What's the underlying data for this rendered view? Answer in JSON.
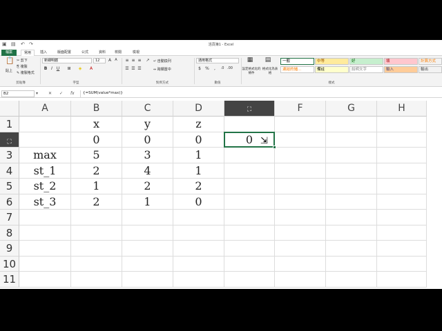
{
  "title_bar": {
    "doc_title": "活頁簿1 - Excel",
    "qa_icons": [
      "save-icon",
      "undo-icon",
      "redo-icon"
    ]
  },
  "ribbon": {
    "tabs": [
      {
        "label": "檔案",
        "state": "file"
      },
      {
        "label": "常用",
        "state": "active"
      },
      {
        "label": "插入"
      },
      {
        "label": "版面配置"
      },
      {
        "label": "公式"
      },
      {
        "label": "資料"
      },
      {
        "label": "校閱"
      },
      {
        "label": "檢視"
      }
    ],
    "clipboard": {
      "paste_label": "貼上",
      "cut_label": "剪下",
      "copy_label": "複製",
      "format_painter_label": "複製格式",
      "group_label": "剪貼簿"
    },
    "font": {
      "name": "新細明體",
      "size": "12",
      "group_label": "字型"
    },
    "alignment": {
      "wrap_label": "自動換列",
      "merge_label": "跨欄置中",
      "group_label": "對齊方式"
    },
    "number": {
      "format": "通用格式",
      "group_label": "數值"
    },
    "styles": {
      "conditional_label": "設定格式化的條件",
      "table_label": "格式化為表格",
      "cells": [
        {
          "label": "一般",
          "bg": "#ffffff",
          "color": "#000000",
          "border": "#217346"
        },
        {
          "label": "中等",
          "bg": "#ffeb9c",
          "color": "#9c5700"
        },
        {
          "label": "好",
          "bg": "#c6efce",
          "color": "#006100"
        },
        {
          "label": "壞",
          "bg": "#ffc7ce",
          "color": "#9c0006"
        },
        {
          "label": "計算方式",
          "bg": "#f2f2f2",
          "color": "#fa7d00"
        },
        {
          "label": "連結的儲...",
          "bg": "#ffffff",
          "color": "#fa7d00"
        },
        {
          "label": "備註",
          "bg": "#ffffcc",
          "color": "#000000"
        },
        {
          "label": "說明文字",
          "bg": "#ffffff",
          "color": "#7f7f7f"
        },
        {
          "label": "輸入",
          "bg": "#ffcc99",
          "color": "#3f3f76"
        },
        {
          "label": "輸出",
          "bg": "#f2f2f2",
          "color": "#3f3f3f"
        }
      ],
      "group_label": "樣式"
    }
  },
  "formula_bar": {
    "name_box": "B2",
    "formula": "{=SUM(value*max)}"
  },
  "sheet": {
    "columns": [
      "A",
      "B",
      "C",
      "D",
      "E",
      "F",
      "G",
      "H"
    ],
    "selected_column": "E",
    "rows": [
      {
        "n": "1",
        "cells": [
          "",
          "x",
          "y",
          "z",
          "",
          "",
          "",
          ""
        ]
      },
      {
        "n": "2",
        "cells": [
          "",
          "0",
          "0",
          "0",
          "0",
          "",
          "",
          ""
        ]
      },
      {
        "n": "3",
        "cells": [
          "max",
          "5",
          "3",
          "1",
          "",
          "",
          "",
          ""
        ]
      },
      {
        "n": "4",
        "cells": [
          "st_1",
          "2",
          "4",
          "1",
          "",
          "",
          "",
          ""
        ]
      },
      {
        "n": "5",
        "cells": [
          "st_2",
          "1",
          "2",
          "2",
          "",
          "",
          "",
          ""
        ]
      },
      {
        "n": "6",
        "cells": [
          "st_3",
          "2",
          "1",
          "0",
          "",
          "",
          "",
          ""
        ]
      },
      {
        "n": "7",
        "cells": [
          "",
          "",
          "",
          "",
          "",
          "",
          "",
          ""
        ]
      },
      {
        "n": "8",
        "cells": [
          "",
          "",
          "",
          "",
          "",
          "",
          "",
          ""
        ]
      },
      {
        "n": "9",
        "cells": [
          "",
          "",
          "",
          "",
          "",
          "",
          "",
          ""
        ]
      },
      {
        "n": "10",
        "cells": [
          "",
          "",
          "",
          "",
          "",
          "",
          "",
          ""
        ]
      },
      {
        "n": "11",
        "cells": [
          "",
          "",
          "",
          "",
          "",
          "",
          "",
          ""
        ]
      }
    ],
    "selected_row": "2",
    "active_cell": "E2",
    "accent_color": "#217346"
  }
}
